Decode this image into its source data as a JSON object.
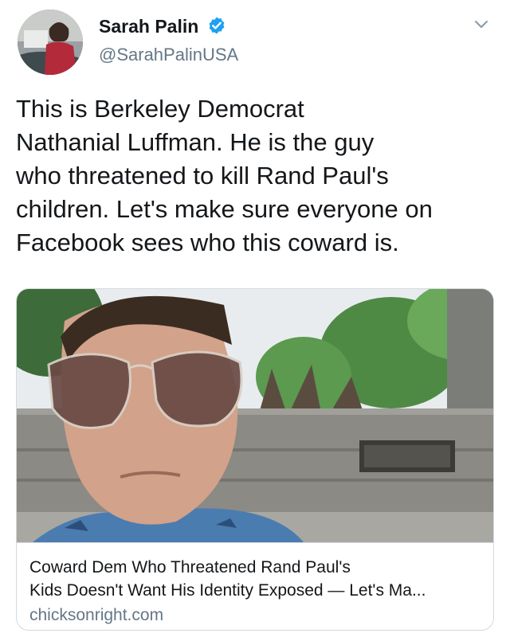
{
  "author": {
    "name": "Sarah Palin",
    "handle": "@SarahPalinUSA",
    "avatar_icon": "profile-photo",
    "verified_icon": "verified-badge-icon",
    "verified_color": "#1da1f2",
    "menu_icon": "chevron-down-icon"
  },
  "tweet": {
    "text_lines": [
      "This is Berkeley Democrat",
      "Nathanial Luffman. He is the guy",
      "who threatened to kill Rand Paul's",
      "children. Let's make sure everyone on",
      "Facebook sees who this coward is."
    ]
  },
  "link_card": {
    "image_icon": "article-photo",
    "title_lines": [
      "Coward Dem Who Threatened Rand Paul's",
      "Kids Doesn't Want His Identity Exposed — Let's Ma..."
    ],
    "domain": "chicksonright.com"
  },
  "colors": {
    "text": "#14171a",
    "secondary": "#657786",
    "border": "#d3d9de"
  }
}
